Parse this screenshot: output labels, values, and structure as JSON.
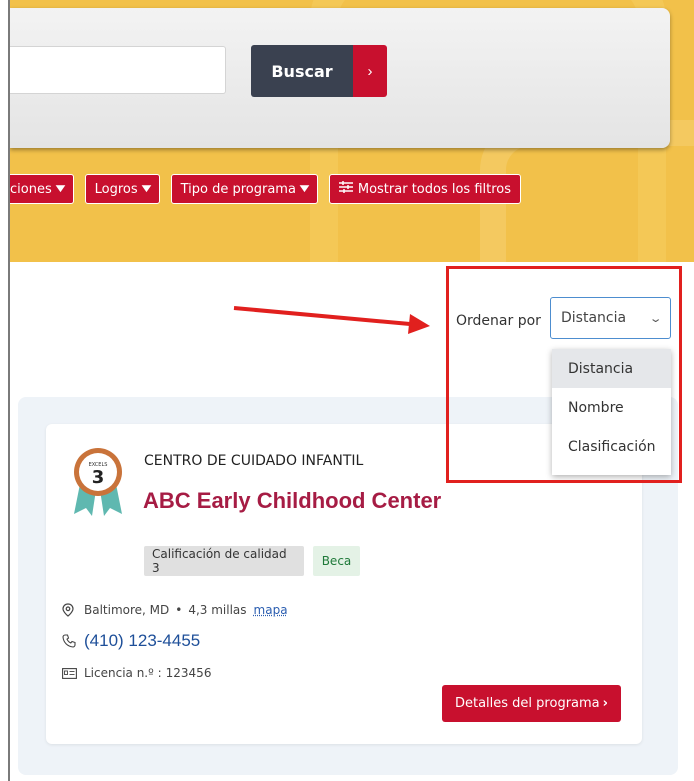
{
  "search": {
    "input_value": "",
    "button_label": "Buscar",
    "button_arrow": "›"
  },
  "filters": {
    "items": [
      {
        "label": "ciones",
        "chevron": "chevron-down-icon"
      },
      {
        "label": "Logros",
        "chevron": "chevron-down-icon"
      },
      {
        "label": "Tipo de programa",
        "chevron": "chevron-down-icon"
      },
      {
        "label": "Mostrar todos los filtros",
        "icon": "sliders-icon"
      }
    ]
  },
  "sort": {
    "label": "Ordenar por",
    "selected": "Distancia",
    "options": [
      "Distancia",
      "Nombre",
      "Clasificación"
    ]
  },
  "result": {
    "badge_text": "EXCELS",
    "badge_level": "3",
    "category": "CENTRO DE CUIDADO INFANTIL",
    "name": "ABC Early Childhood Center",
    "tags": [
      "Calificación de calidad 3",
      "Beca"
    ],
    "location": "Baltimore, MD",
    "distance": "4,3 millas",
    "map_link": "mapa",
    "phone": "(410) 123-4455",
    "license_label": "Licencia n.º :",
    "license_number": "123456",
    "details_button": "Detalles del programa",
    "details_arrow": "›"
  },
  "colors": {
    "brand_red": "#c8102e",
    "hero_yellow": "#f2c14a",
    "title_crimson": "#a61c44",
    "annotation_red": "#e1201e",
    "button_dark": "#3a4150"
  }
}
